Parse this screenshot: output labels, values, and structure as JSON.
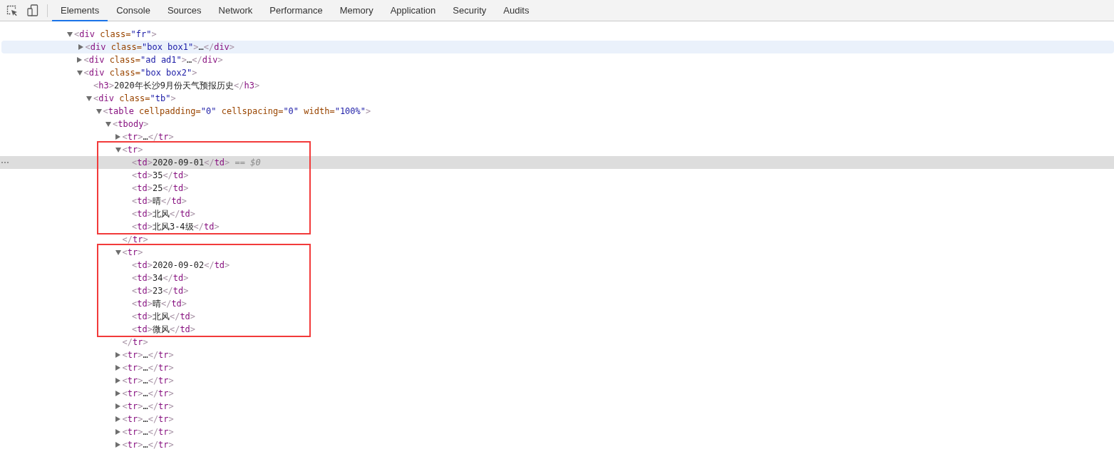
{
  "toolbar": {
    "tabs": [
      {
        "label": "Elements",
        "selected": true
      },
      {
        "label": "Console",
        "selected": false
      },
      {
        "label": "Sources",
        "selected": false
      },
      {
        "label": "Network",
        "selected": false
      },
      {
        "label": "Performance",
        "selected": false
      },
      {
        "label": "Memory",
        "selected": false
      },
      {
        "label": "Application",
        "selected": false
      },
      {
        "label": "Security",
        "selected": false
      },
      {
        "label": "Audits",
        "selected": false
      }
    ]
  },
  "dom_tree": [
    {
      "expanded": true,
      "selected": false,
      "hovered": false,
      "marked": false,
      "markup": "<div class=\"fr\">",
      "children": [
        {
          "expanded": false,
          "selected": false,
          "hovered": true,
          "marked": false,
          "markup": "<div class=\"box box1\">…</div>"
        },
        {
          "expanded": false,
          "selected": false,
          "hovered": false,
          "marked": false,
          "markup": "<div class=\"ad ad1\">…</div>"
        },
        {
          "expanded": true,
          "selected": false,
          "hovered": false,
          "marked": false,
          "markup": "<div class=\"box box2\">",
          "children": [
            {
              "selected": false,
              "hovered": false,
              "marked": false,
              "markup": "<h3>2020年长沙9月份天气预报历史</h3>"
            },
            {
              "expanded": true,
              "selected": false,
              "hovered": false,
              "marked": false,
              "markup": "<div class=\"tb\">",
              "children": [
                {
                  "expanded": true,
                  "selected": false,
                  "hovered": false,
                  "marked": false,
                  "markup": "<table cellpadding=\"0\" cellspacing=\"0\" width=\"100%\">",
                  "children": [
                    {
                      "expanded": true,
                      "selected": false,
                      "hovered": false,
                      "marked": false,
                      "markup": "<tbody>",
                      "children": [
                        {
                          "expanded": false,
                          "selected": false,
                          "hovered": false,
                          "marked": false,
                          "markup": "<tr>…</tr>"
                        },
                        {
                          "expanded": true,
                          "selected": false,
                          "hovered": false,
                          "marked": true,
                          "markup": "<tr>",
                          "close": "</tr>",
                          "children": [
                            {
                              "selected": true,
                              "hovered": false,
                              "marked": false,
                              "markup": "<td>2020-09-01</td>",
                              "console_ref": "== $0"
                            },
                            {
                              "selected": false,
                              "hovered": false,
                              "marked": false,
                              "markup": "<td>35</td>"
                            },
                            {
                              "selected": false,
                              "hovered": false,
                              "marked": false,
                              "markup": "<td>25</td>"
                            },
                            {
                              "selected": false,
                              "hovered": false,
                              "marked": false,
                              "markup": "<td>晴</td>"
                            },
                            {
                              "selected": false,
                              "hovered": false,
                              "marked": false,
                              "markup": "<td>北风</td>"
                            },
                            {
                              "selected": false,
                              "hovered": false,
                              "marked": false,
                              "markup": "<td>北风3-4级</td>"
                            }
                          ]
                        },
                        {
                          "expanded": true,
                          "selected": false,
                          "hovered": false,
                          "marked": true,
                          "markup": "<tr>",
                          "close": "</tr>",
                          "children": [
                            {
                              "selected": false,
                              "hovered": false,
                              "marked": false,
                              "markup": "<td>2020-09-02</td>"
                            },
                            {
                              "selected": false,
                              "hovered": false,
                              "marked": false,
                              "markup": "<td>34</td>"
                            },
                            {
                              "selected": false,
                              "hovered": false,
                              "marked": false,
                              "markup": "<td>23</td>"
                            },
                            {
                              "selected": false,
                              "hovered": false,
                              "marked": false,
                              "markup": "<td>晴</td>"
                            },
                            {
                              "selected": false,
                              "hovered": false,
                              "marked": false,
                              "markup": "<td>北风</td>"
                            },
                            {
                              "selected": false,
                              "hovered": false,
                              "marked": false,
                              "markup": "<td>微风</td>"
                            }
                          ]
                        },
                        {
                          "expanded": false,
                          "selected": false,
                          "hovered": false,
                          "marked": false,
                          "markup": "<tr>…</tr>"
                        },
                        {
                          "expanded": false,
                          "selected": false,
                          "hovered": false,
                          "marked": false,
                          "markup": "<tr>…</tr>"
                        },
                        {
                          "expanded": false,
                          "selected": false,
                          "hovered": false,
                          "marked": false,
                          "markup": "<tr>…</tr>"
                        },
                        {
                          "expanded": false,
                          "selected": false,
                          "hovered": false,
                          "marked": false,
                          "markup": "<tr>…</tr>"
                        },
                        {
                          "expanded": false,
                          "selected": false,
                          "hovered": false,
                          "marked": false,
                          "markup": "<tr>…</tr>"
                        },
                        {
                          "expanded": false,
                          "selected": false,
                          "hovered": false,
                          "marked": false,
                          "markup": "<tr>…</tr>"
                        },
                        {
                          "expanded": false,
                          "selected": false,
                          "hovered": false,
                          "marked": false,
                          "markup": "<tr>…</tr>"
                        },
                        {
                          "expanded": false,
                          "selected": false,
                          "hovered": false,
                          "marked": false,
                          "markup": "<tr>…</tr>"
                        }
                      ]
                    }
                  ]
                }
              ]
            }
          ]
        }
      ]
    }
  ]
}
